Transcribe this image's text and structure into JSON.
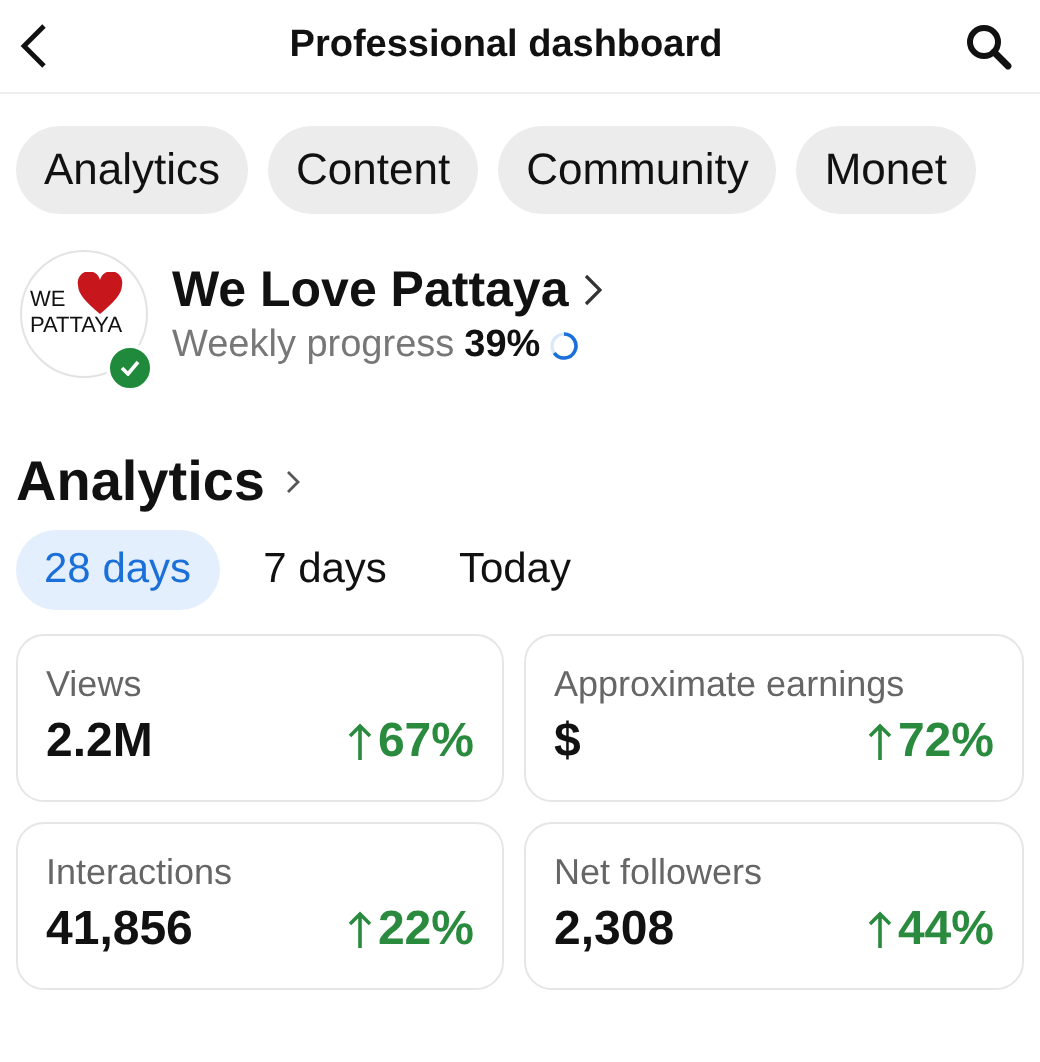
{
  "header": {
    "title": "Professional dashboard"
  },
  "chips": [
    {
      "label": "Analytics"
    },
    {
      "label": "Content"
    },
    {
      "label": "Community"
    },
    {
      "label": "Monet"
    }
  ],
  "profile": {
    "logo_lines": [
      "WE",
      "PATTAYA"
    ],
    "verified": true,
    "name": "We Love Pattaya",
    "progress_label": "Weekly progress",
    "progress_value": "39%"
  },
  "analytics": {
    "title": "Analytics",
    "ranges": [
      {
        "label": "28 days",
        "selected": true
      },
      {
        "label": "7 days",
        "selected": false
      },
      {
        "label": "Today",
        "selected": false
      }
    ],
    "cards": [
      {
        "label": "Views",
        "value": "2.2M",
        "change": "67%"
      },
      {
        "label": "Approximate earnings",
        "value": "$",
        "change": "72%"
      },
      {
        "label": "Interactions",
        "value": "41,856",
        "change": "22%"
      },
      {
        "label": "Net followers",
        "value": "2,308",
        "change": "44%"
      }
    ]
  }
}
